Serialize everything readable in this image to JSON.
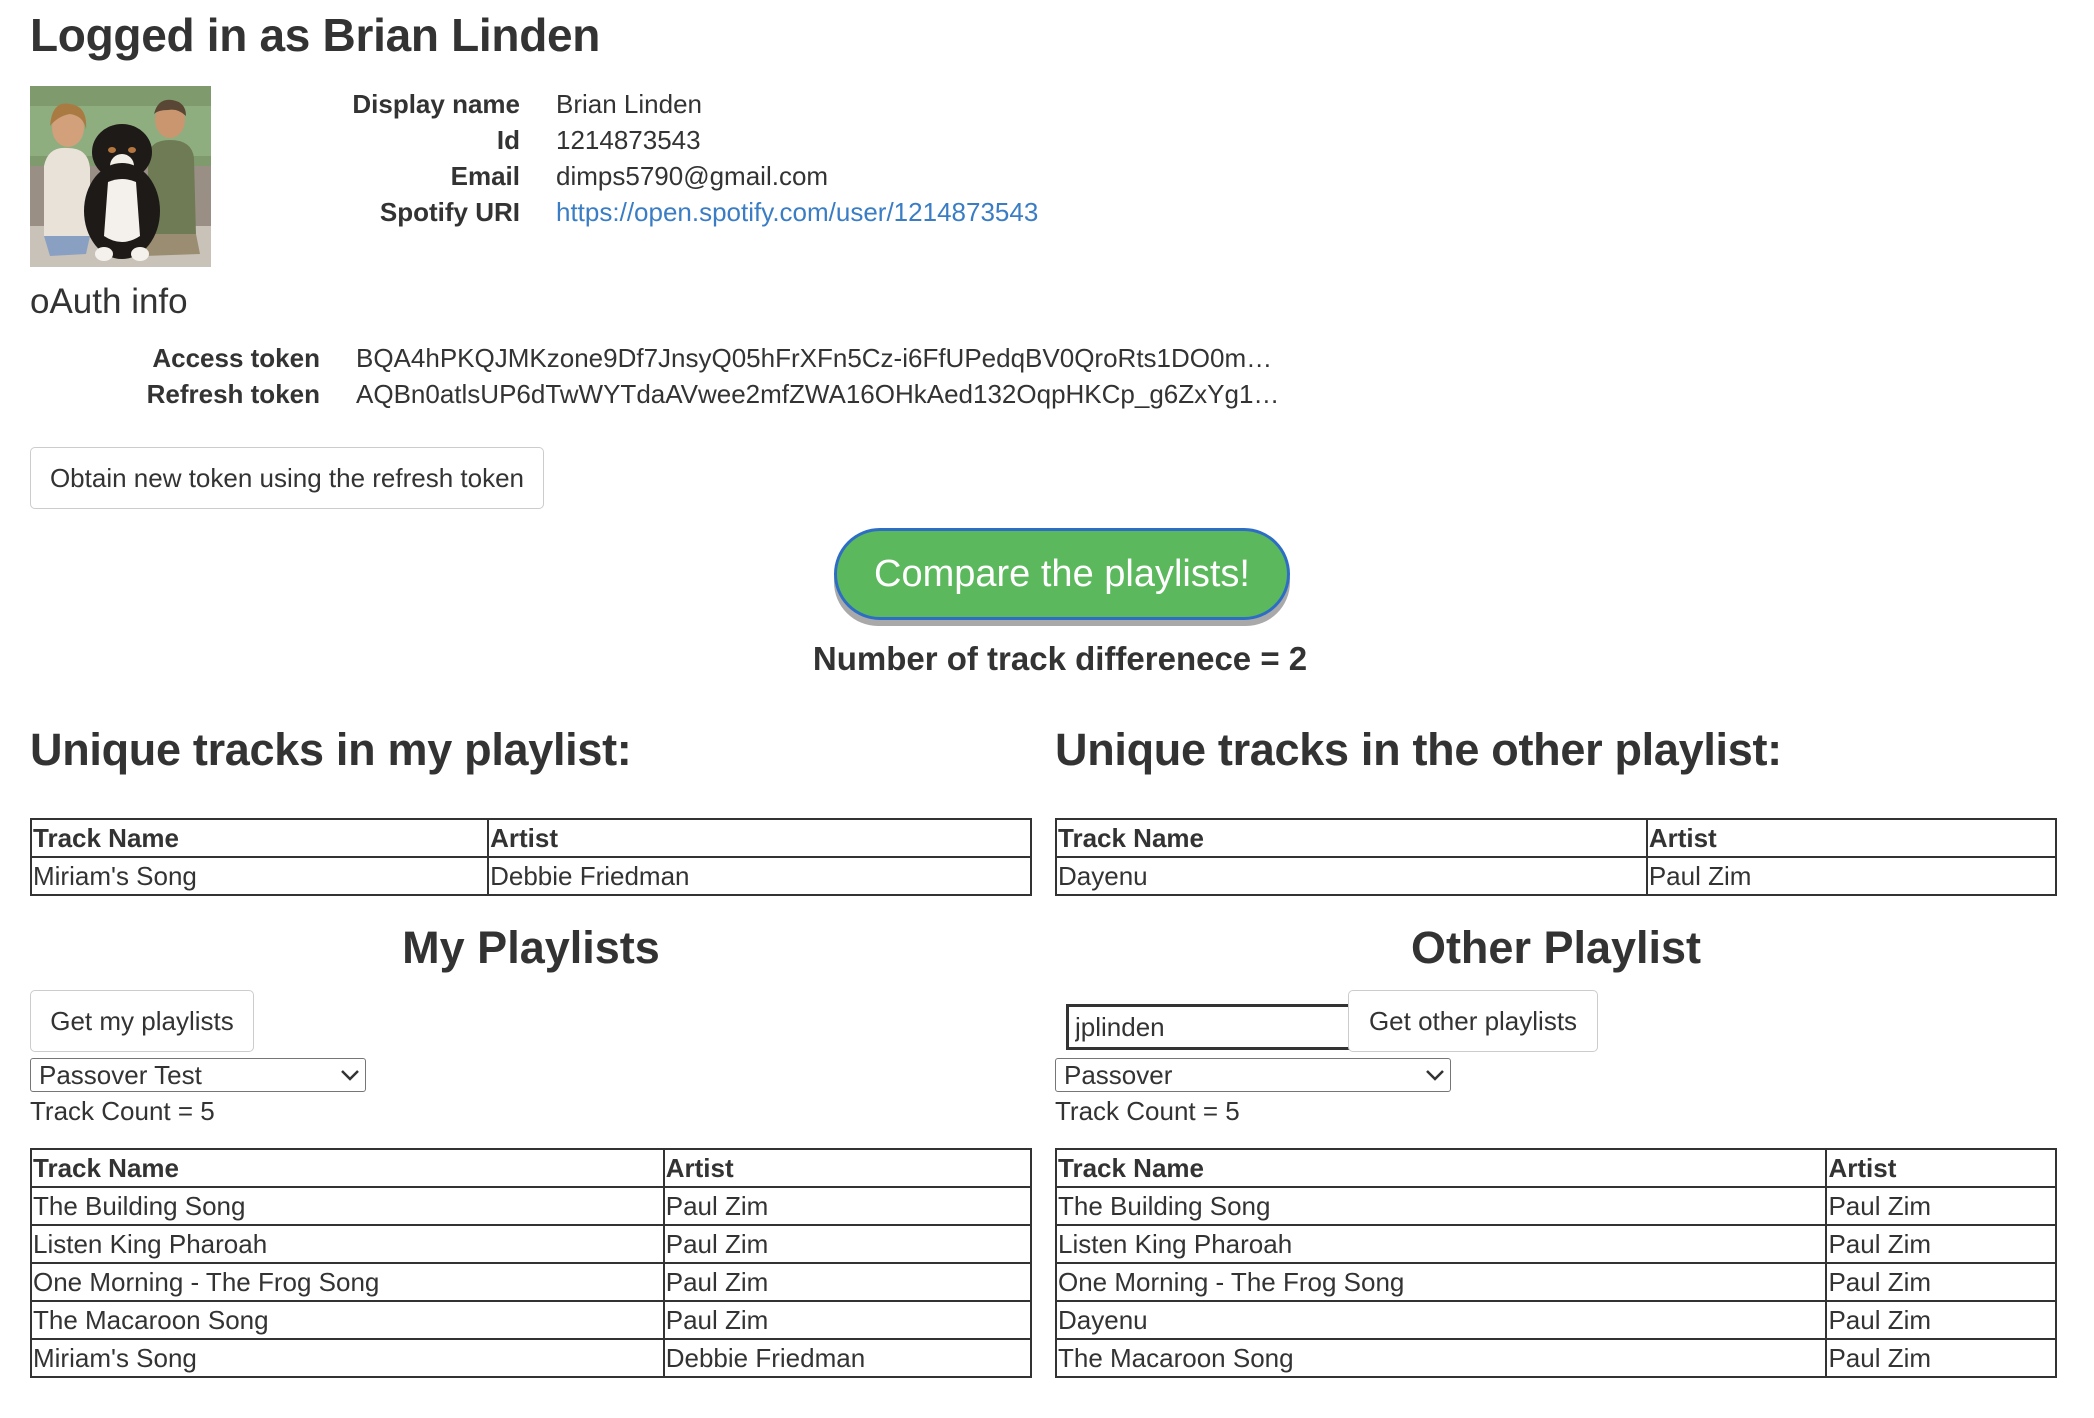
{
  "header": {
    "title": "Logged in as Brian Linden"
  },
  "profile": {
    "avatar_icon": "profile-photo",
    "fields": [
      {
        "label": "Display name",
        "value": "Brian Linden"
      },
      {
        "label": "Id",
        "value": "1214873543"
      },
      {
        "label": "Email",
        "value": "dimps5790@gmail.com"
      },
      {
        "label": "Spotify URI",
        "value": "https://open.spotify.com/user/1214873543"
      }
    ]
  },
  "oauth": {
    "title": "oAuth info",
    "fields": [
      {
        "label": "Access token",
        "value": "BQA4hPKQJMKzone9Df7JnsyQ05hFrXFn5Cz-i6FfUPedqBV0QroRts1DO0mA…"
      },
      {
        "label": "Refresh token",
        "value": "AQBn0atlsUP6dTwWYTdaAVwee2mfZWA16OHkAed132OqpHKCp_g6ZxYg1…"
      }
    ],
    "refresh_button": "Obtain new token using the refresh token"
  },
  "compare": {
    "button_label": "Compare the playlists!",
    "difference_text": "Number of track differenece = 2",
    "button_color": "#5cb85c",
    "button_border": "#2e6dc5"
  },
  "unique_mine": {
    "title": "Unique tracks in my playlist:",
    "columns": [
      "Track Name",
      "Artist"
    ],
    "rows": [
      [
        "Miriam's Song",
        "Debbie Friedman"
      ]
    ]
  },
  "unique_other": {
    "title": "Unique tracks in the other playlist:",
    "columns": [
      "Track Name",
      "Artist"
    ],
    "rows": [
      [
        "Dayenu",
        "Paul Zim"
      ]
    ]
  },
  "my_playlists": {
    "title": "My Playlists",
    "get_button": "Get my playlists",
    "selected": "Passover Test",
    "track_count": "Track Count = 5",
    "columns": [
      "Track Name",
      "Artist"
    ],
    "rows": [
      [
        "The Building Song",
        "Paul Zim"
      ],
      [
        "Listen King Pharoah",
        "Paul Zim"
      ],
      [
        "One Morning - The Frog Song",
        "Paul Zim"
      ],
      [
        "The Macaroon Song",
        "Paul Zim"
      ],
      [
        "Miriam's Song",
        "Debbie Friedman"
      ]
    ]
  },
  "other_playlist": {
    "title": "Other Playlist",
    "username_value": "jplinden",
    "get_button": "Get other playlists",
    "selected": "Passover",
    "track_count": "Track Count = 5",
    "columns": [
      "Track Name",
      "Artist"
    ],
    "rows": [
      [
        "The Building Song",
        "Paul Zim"
      ],
      [
        "Listen King Pharoah",
        "Paul Zim"
      ],
      [
        "One Morning - The Frog Song",
        "Paul Zim"
      ],
      [
        "Dayenu",
        "Paul Zim"
      ],
      [
        "The Macaroon Song",
        "Paul Zim"
      ]
    ]
  }
}
